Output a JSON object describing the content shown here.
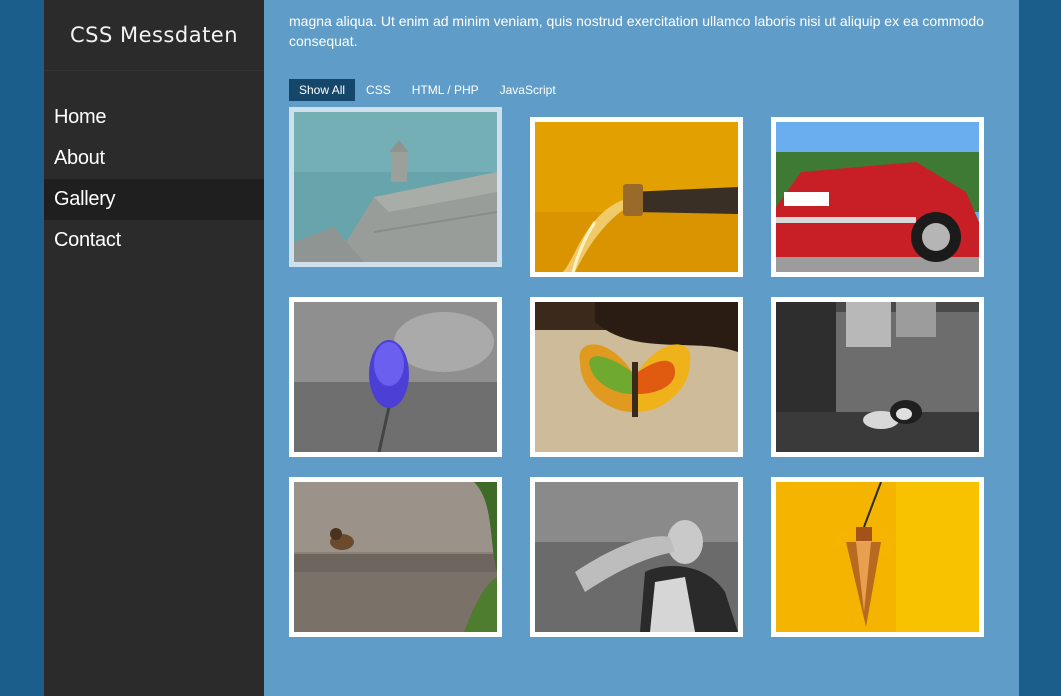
{
  "site": {
    "title": "CSS Messdaten"
  },
  "nav": {
    "items": [
      {
        "label": "Home"
      },
      {
        "label": "About"
      },
      {
        "label": "Gallery",
        "active": true
      },
      {
        "label": "Contact"
      }
    ]
  },
  "intro": {
    "text": "magna aliqua. Ut enim ad minim veniam, quis nostrud exercitation ullamco laboris nisi ut aliquip ex ea commodo consequat."
  },
  "filters": {
    "items": [
      {
        "label": "Show All",
        "active": true
      },
      {
        "label": "CSS"
      },
      {
        "label": "HTML / PHP"
      },
      {
        "label": "JavaScript"
      }
    ]
  },
  "gallery": {
    "items": [
      {
        "subject": "sea-fortress-photo"
      },
      {
        "subject": "water-hose-photo"
      },
      {
        "subject": "red-car-photo"
      },
      {
        "subject": "purple-flower-photo"
      },
      {
        "subject": "butterfly-photo"
      },
      {
        "subject": "sleeping-dogs-photo"
      },
      {
        "subject": "bird-on-fence-photo"
      },
      {
        "subject": "stretching-man-photo"
      },
      {
        "subject": "pendulum-photo"
      }
    ]
  },
  "colors": {
    "page_bg": "#1b5e8c",
    "sidebar_bg": "#2b2b2b",
    "main_bg": "#5f9dc8",
    "active_filter": "#15476b"
  }
}
